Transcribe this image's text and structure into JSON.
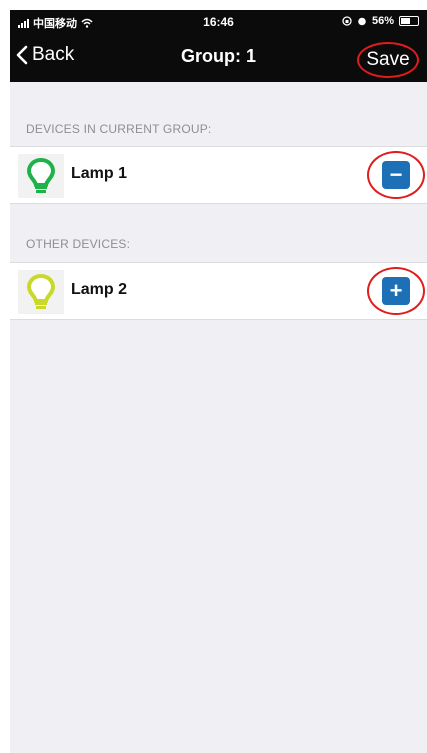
{
  "status_bar": {
    "carrier": "中国移动",
    "time": "16:46",
    "battery_percent": "56%",
    "battery_level": 0.56
  },
  "nav": {
    "back_label": "Back",
    "title": "Group: 1",
    "save_label": "Save"
  },
  "sections": {
    "current": {
      "header": "DEVICES IN CURRENT GROUP:",
      "items": [
        {
          "label": "Lamp 1",
          "action": "−",
          "icon": "bulb-green-icon",
          "color": "#1fb24a"
        }
      ]
    },
    "other": {
      "header": "OTHER DEVICES:",
      "items": [
        {
          "label": "Lamp 2",
          "action": "+",
          "icon": "bulb-yellow-icon",
          "color": "#c9d92a"
        }
      ]
    }
  },
  "colors": {
    "accent_button": "#1d6fb6",
    "highlight_ring": "#e01c1c",
    "background": "#efeff4",
    "nav_background": "#0b0b0b"
  }
}
